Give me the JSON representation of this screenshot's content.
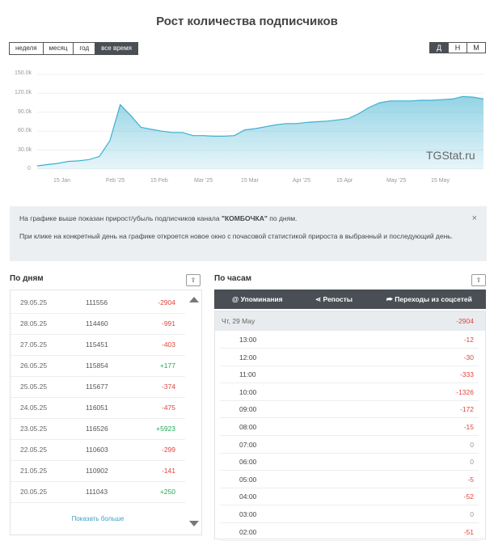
{
  "title": "Рост количества подписчиков",
  "range_buttons": [
    "неделя",
    "месяц",
    "год",
    "все время"
  ],
  "range_active": "все время",
  "granularity_buttons": [
    "Д",
    "Н",
    "М"
  ],
  "granularity_active": "Д",
  "chart_data": {
    "type": "area",
    "ylim": [
      0,
      150000
    ],
    "y_ticks": [
      "150.0k",
      "120.0k",
      "90.0k",
      "60.0k",
      "30.0k",
      "0"
    ],
    "x_ticks": [
      "15 Jan",
      "Feb '25",
      "15 Feb",
      "Mar '25",
      "15 Mar",
      "Apr '25",
      "15 Apr",
      "May '25",
      "15 May"
    ],
    "color": "#3cb0d0",
    "series": [
      {
        "values": [
          5000,
          7000,
          9000,
          12000,
          13000,
          15000,
          20000,
          45000,
          102000,
          85000,
          66000,
          63000,
          60000,
          58000,
          58000,
          53000,
          53000,
          52000,
          52000,
          53000,
          62000,
          64000,
          67000,
          70000,
          72000,
          72000,
          74000,
          75000,
          76000,
          78000,
          80000,
          88000,
          98000,
          105000,
          108000,
          108000,
          108000,
          109000,
          109000,
          110000,
          111000,
          115000,
          114000,
          111000
        ]
      }
    ],
    "watermark": "TGStat.ru"
  },
  "info": {
    "line1_pre": "На графике выше показан прирост/убыль подписчиков канала ",
    "channel": "\"КОМБОЧКА\"",
    "line1_post": " по дням.",
    "line2": "При клике на конкретный день на графике откроется новое окно с почасовой статистикой прироста в выбранный и последующий день.",
    "close": "×"
  },
  "days": {
    "title": "По дням",
    "export_icon": "⇪",
    "rows": [
      {
        "date": "29.05.25",
        "count": "111556",
        "delta": "-2904",
        "sign": "neg"
      },
      {
        "date": "28.05.25",
        "count": "114460",
        "delta": "-991",
        "sign": "neg"
      },
      {
        "date": "27.05.25",
        "count": "115451",
        "delta": "-403",
        "sign": "neg"
      },
      {
        "date": "26.05.25",
        "count": "115854",
        "delta": "+177",
        "sign": "pos"
      },
      {
        "date": "25.05.25",
        "count": "115677",
        "delta": "-374",
        "sign": "neg"
      },
      {
        "date": "24.05.25",
        "count": "116051",
        "delta": "-475",
        "sign": "neg"
      },
      {
        "date": "23.05.25",
        "count": "116526",
        "delta": "+5923",
        "sign": "pos"
      },
      {
        "date": "22.05.25",
        "count": "110603",
        "delta": "-299",
        "sign": "neg"
      },
      {
        "date": "21.05.25",
        "count": "110902",
        "delta": "-141",
        "sign": "neg"
      },
      {
        "date": "20.05.25",
        "count": "111043",
        "delta": "+250",
        "sign": "pos"
      }
    ],
    "show_more": "Показать больше"
  },
  "hours": {
    "title": "По часам",
    "export_icon": "⇪",
    "tabs": [
      "Упоминания",
      "Репосты",
      "Переходы из соцсетей"
    ],
    "tab_icons": [
      "@",
      "⋖",
      "⮫"
    ],
    "day_label": "Чт, 29 May",
    "day_total": "-2904",
    "rows": [
      {
        "time": "13:00",
        "delta": "-12",
        "sign": "neg"
      },
      {
        "time": "12:00",
        "delta": "-30",
        "sign": "neg"
      },
      {
        "time": "11:00",
        "delta": "-333",
        "sign": "neg"
      },
      {
        "time": "10:00",
        "delta": "-1326",
        "sign": "neg"
      },
      {
        "time": "09:00",
        "delta": "-172",
        "sign": "neg"
      },
      {
        "time": "08:00",
        "delta": "-15",
        "sign": "neg"
      },
      {
        "time": "07:00",
        "delta": "0",
        "sign": "zero"
      },
      {
        "time": "06:00",
        "delta": "0",
        "sign": "zero"
      },
      {
        "time": "05:00",
        "delta": "-5",
        "sign": "neg"
      },
      {
        "time": "04:00",
        "delta": "-52",
        "sign": "neg"
      },
      {
        "time": "03:00",
        "delta": "0",
        "sign": "zero"
      },
      {
        "time": "02:00",
        "delta": "-51",
        "sign": "neg"
      }
    ]
  }
}
